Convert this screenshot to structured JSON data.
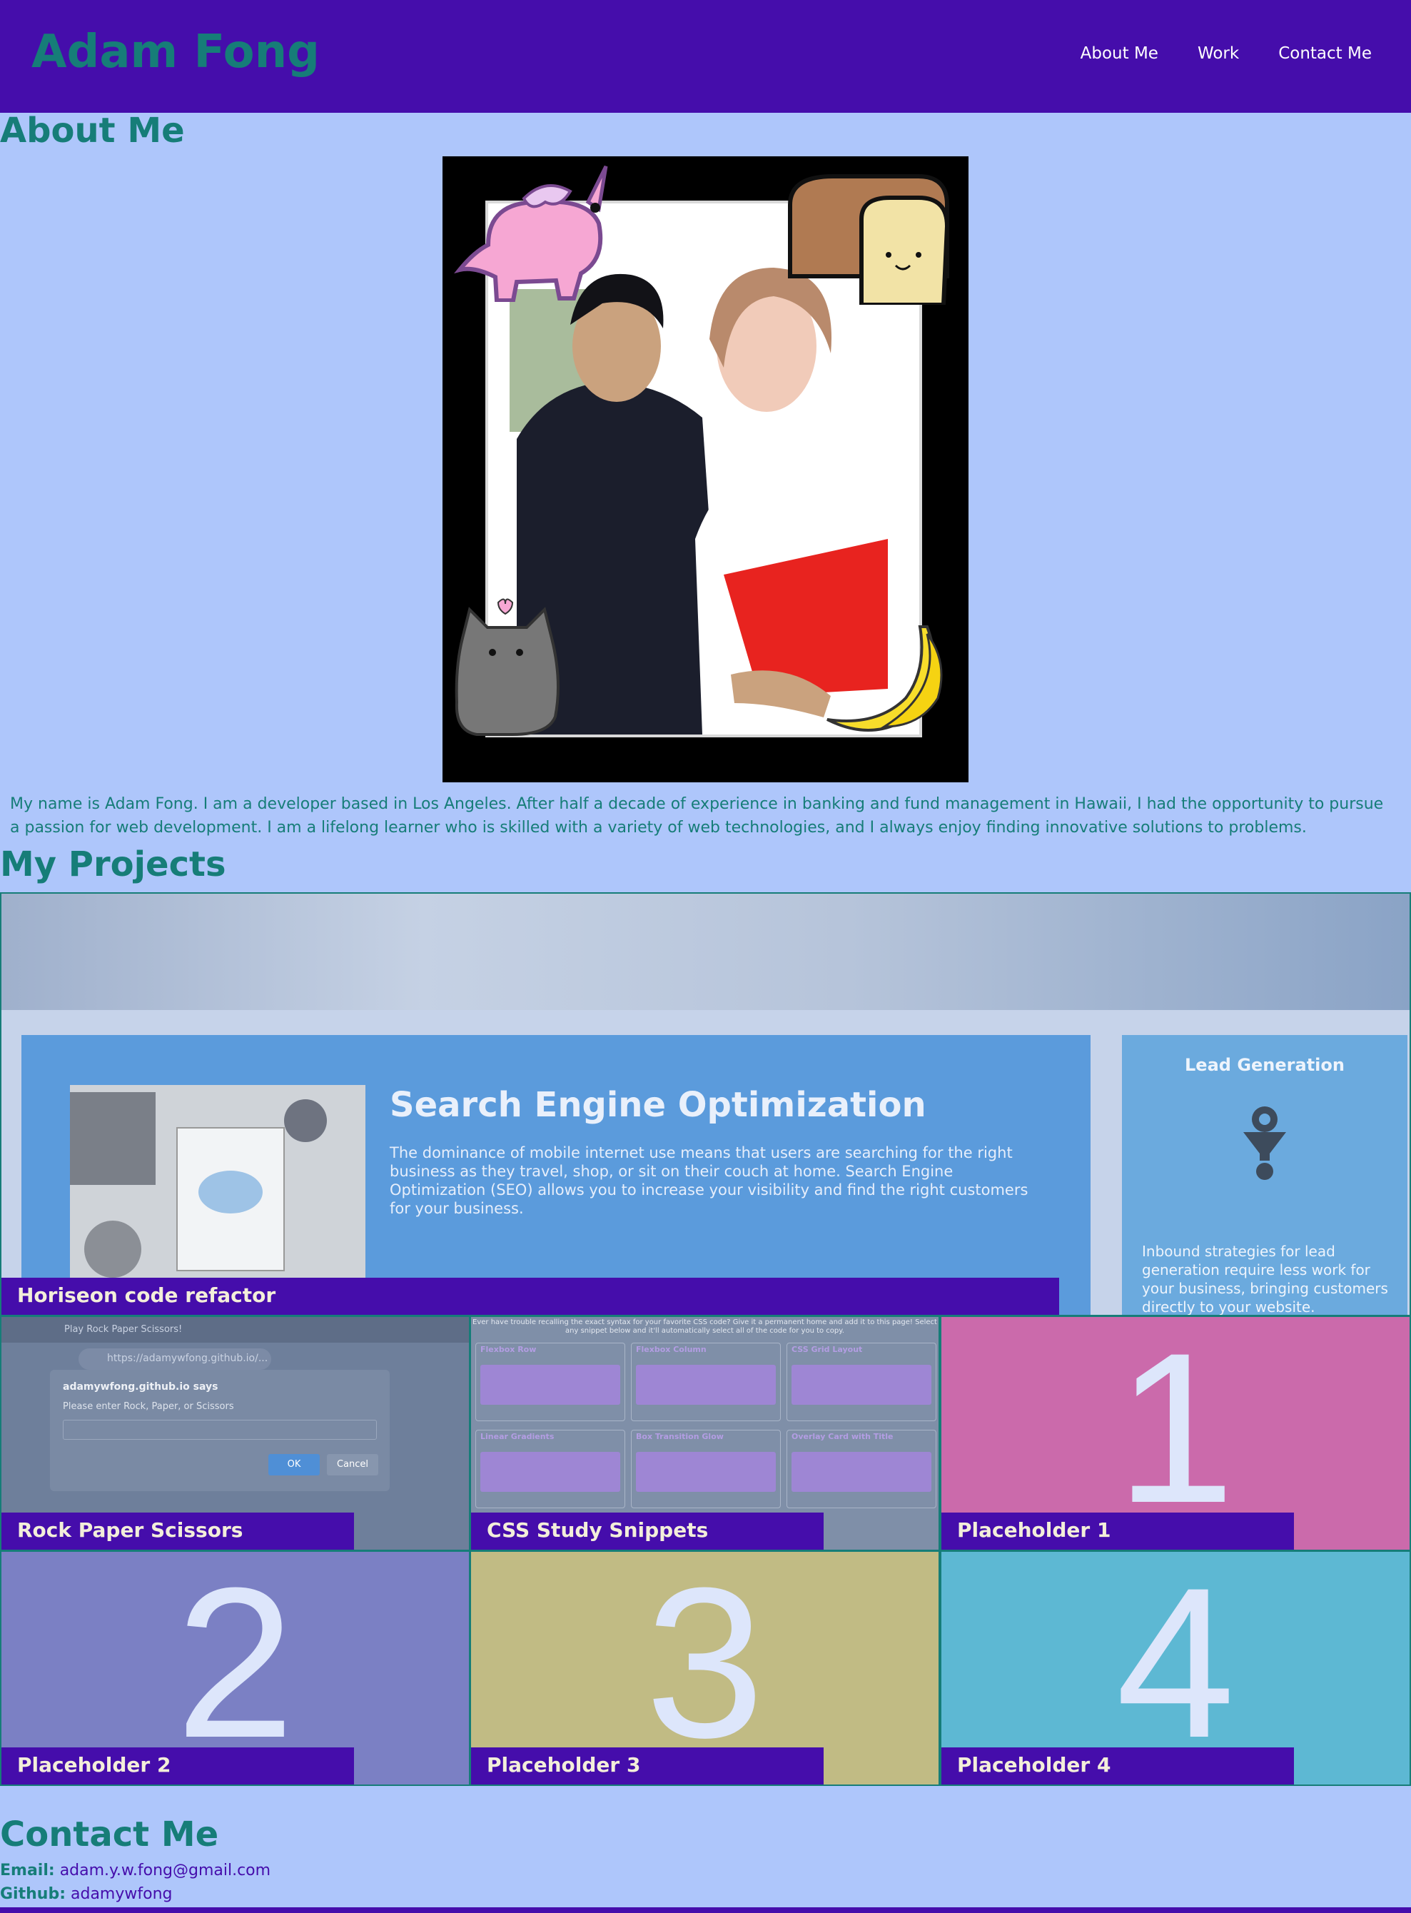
{
  "header": {
    "brand": "Adam Fong",
    "nav": [
      "About Me",
      "Work",
      "Contact Me"
    ]
  },
  "about": {
    "heading": "About Me",
    "bio": "My name is Adam Fong. I am a developer based in Los Angeles. After half a decade of experience in banking and fund management in Hawaii, I had the opportunity to pursue a passion for web development. I am a lifelong learner who is skilled with a variety of web technologies, and I always enjoy finding innovative solutions to problems."
  },
  "projects": {
    "heading": "My Projects",
    "featured": {
      "label": "Horiseon code refactor",
      "seo_title": "Search Engine Optimization",
      "seo_text": "The dominance of mobile internet use means that users are searching for the right business as they travel, shop, or sit on their couch at home. Search Engine Optimization (SEO) allows you to increase your visibility and find the right customers for your business.",
      "lead_title": "Lead Generation",
      "lead_text": "Inbound strategies for lead generation require less work for your business, bringing customers directly to your website."
    },
    "rps": {
      "label": "Rock Paper Scissors",
      "tab": "Play Rock Paper Scissors!",
      "url": "https://adamywfong.github.io/...",
      "dialog_title": "adamywfong.github.io says",
      "dialog_text": "Please enter Rock, Paper, or Scissors",
      "ok": "OK",
      "cancel": "Cancel"
    },
    "css": {
      "label": "CSS Study Snippets",
      "intro": "Ever have trouble recalling the exact syntax for your favorite CSS code? Give it a permanent home and add it to this page! Select any snippet below and it'll automatically select all of the code for you to copy.",
      "snippets": [
        "Flexbox Row",
        "Flexbox Column",
        "CSS Grid Layout",
        "Linear Gradients",
        "Box Transition Glow",
        "Overlay Card with Title"
      ]
    },
    "placeholders": [
      {
        "label": "Placeholder 1",
        "number": "1"
      },
      {
        "label": "Placeholder 2",
        "number": "2"
      },
      {
        "label": "Placeholder 3",
        "number": "3"
      },
      {
        "label": "Placeholder 4",
        "number": "4"
      }
    ]
  },
  "contact": {
    "heading": "Contact Me",
    "email_label": "Email:",
    "email": "adam.y.w.fong@gmail.com",
    "github_label": "Github:",
    "github": "adamywfong"
  },
  "colors": {
    "header": "#450dab",
    "background": "#aec6fb",
    "accent_text": "#167d78"
  }
}
